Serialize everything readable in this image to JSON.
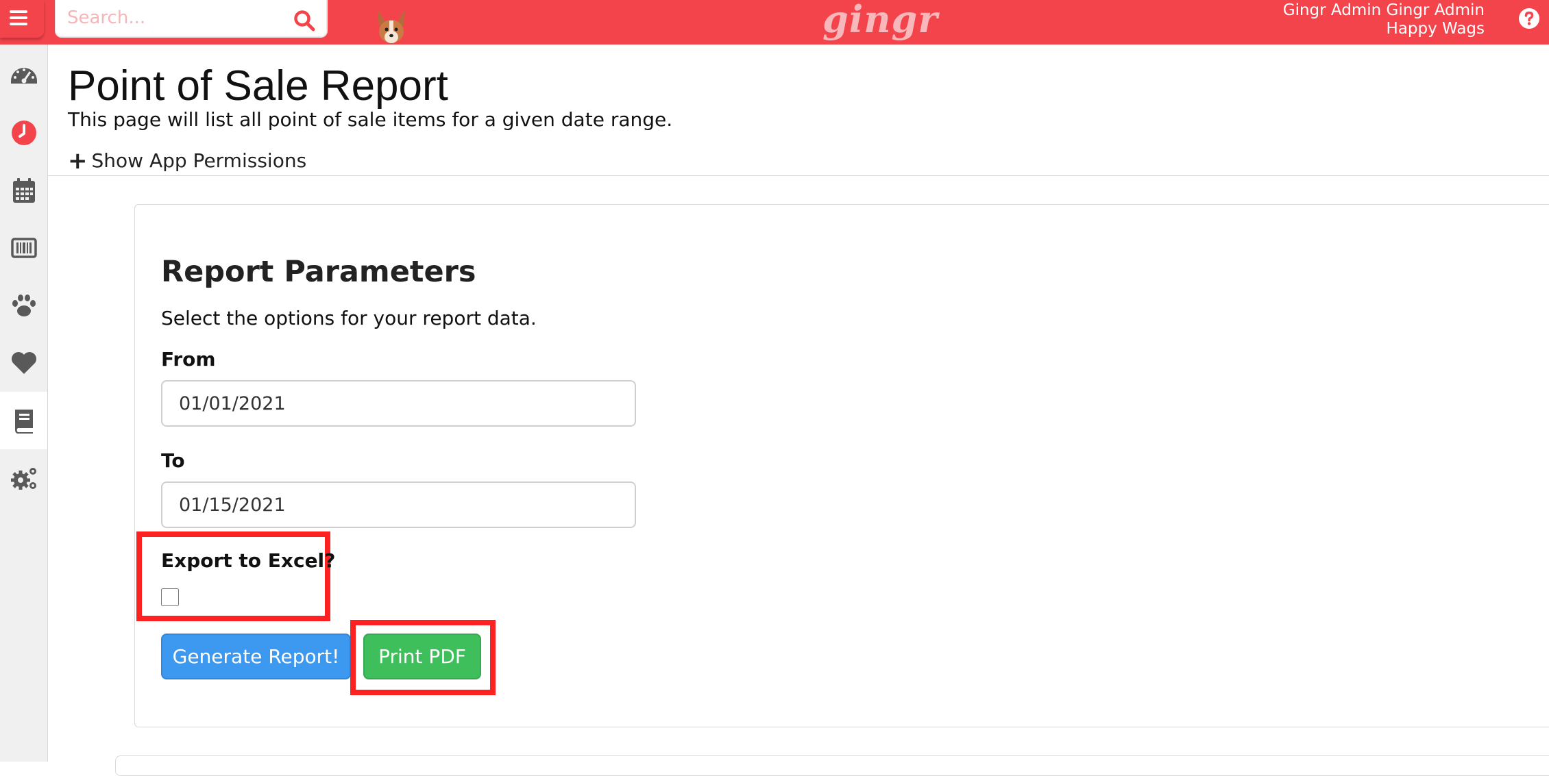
{
  "header": {
    "search_placeholder": "Search...",
    "logo": "gingr",
    "user_name": "Gingr Admin Gingr Admin",
    "location": "Happy Wags",
    "accent_color": "#f4444b"
  },
  "sidebar": {
    "items": [
      {
        "icon": "dashboard-gauge-icon"
      },
      {
        "icon": "clock-icon"
      },
      {
        "icon": "calendar-icon"
      },
      {
        "icon": "barcode-icon"
      },
      {
        "icon": "paw-icon"
      },
      {
        "icon": "heart-icon"
      },
      {
        "icon": "book-icon",
        "active": true
      },
      {
        "icon": "settings-gears-icon"
      }
    ]
  },
  "page": {
    "title": "Point of Sale Report",
    "description": "This page will list all point of sale items for a given date range.",
    "permissions_toggle": "Show App Permissions"
  },
  "report_params": {
    "title": "Report Parameters",
    "description": "Select the options for your report data.",
    "from_label": "From",
    "from_value": "01/01/2021",
    "to_label": "To",
    "to_value": "01/15/2021",
    "export_label": "Export to Excel?",
    "export_checked": false,
    "generate_button": "Generate Report!",
    "print_button": "Print PDF",
    "generate_color": "#3d98ef",
    "print_color": "#3fbf5c",
    "highlight_color": "#fd2222"
  }
}
